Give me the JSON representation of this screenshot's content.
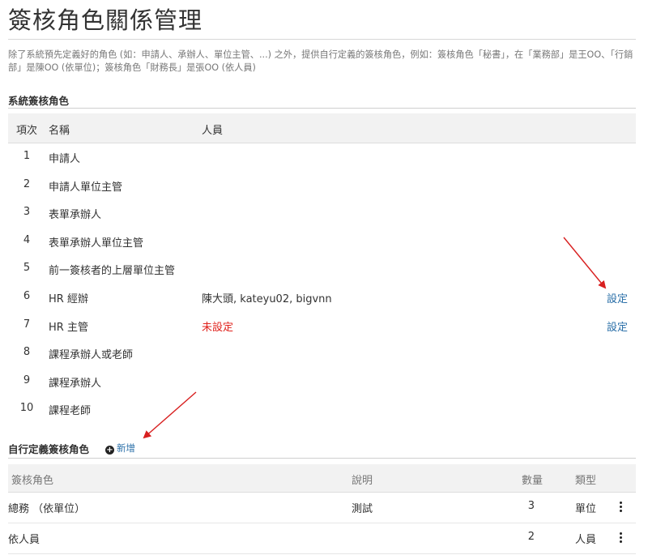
{
  "page": {
    "title": "簽核角色關係管理",
    "description": "除了系統預先定義好的角色 (如：申請人、承辦人、單位主管、...) 之外，提供自行定義的簽核角色，例如：簽核角色「秘書」，在「業務部」是王OO、「行銷部」是陳OO (依單位)；簽核角色「財務長」是張OO (依人員)"
  },
  "system_roles": {
    "heading": "系統簽核角色",
    "columns": {
      "no": "項次",
      "name": "名稱",
      "people": "人員"
    },
    "rows": [
      {
        "no": "1",
        "name": "申請人",
        "people": "",
        "action": ""
      },
      {
        "no": "2",
        "name": "申請人單位主管",
        "people": "",
        "action": ""
      },
      {
        "no": "3",
        "name": "表單承辦人",
        "people": "",
        "action": ""
      },
      {
        "no": "4",
        "name": "表單承辦人單位主管",
        "people": "",
        "action": ""
      },
      {
        "no": "5",
        "name": "前一簽核者的上層單位主管",
        "people": "",
        "action": ""
      },
      {
        "no": "6",
        "name": "HR 經辦",
        "people": "陳大頭, kateyu02, bigvnn",
        "action": "設定"
      },
      {
        "no": "7",
        "name": "HR 主管",
        "people": "未設定",
        "action": "設定"
      },
      {
        "no": "8",
        "name": "課程承辦人或老師",
        "people": "",
        "action": ""
      },
      {
        "no": "9",
        "name": "課程承辦人",
        "people": "",
        "action": ""
      },
      {
        "no": "10",
        "name": "課程老師",
        "people": "",
        "action": ""
      }
    ]
  },
  "custom_roles": {
    "heading": "自行定義簽核角色",
    "add_label": "新增",
    "columns": {
      "role": "簽核角色",
      "desc": "說明",
      "count": "數量",
      "type": "類型"
    },
    "rows": [
      {
        "role": "總務 （依單位）",
        "desc": "測試",
        "count": "3",
        "type": "單位"
      },
      {
        "role": "依人員",
        "desc": "",
        "count": "2",
        "type": "人員"
      }
    ]
  },
  "colors": {
    "link": "#2a6fa8",
    "warning": "#e0221c",
    "annotation_arrow": "#d81f1f"
  }
}
